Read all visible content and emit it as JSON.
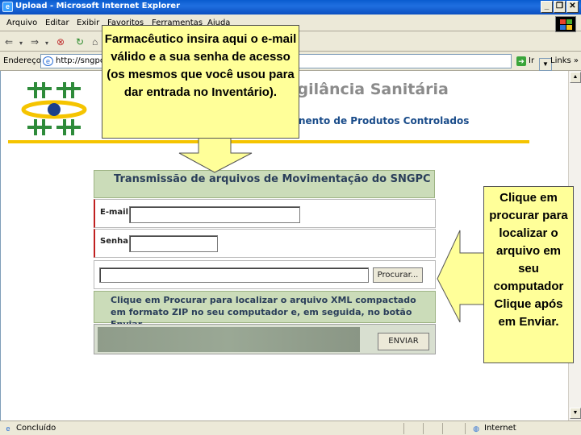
{
  "window": {
    "title": "Upload - Microsoft Internet Explorer",
    "minimize": "_",
    "restore": "❐",
    "close": "✕"
  },
  "menu": [
    "Arquivo",
    "Editar",
    "Exibir",
    "Favoritos",
    "Ferramentas",
    "Ajuda"
  ],
  "address": {
    "label": "Endereço",
    "url": "http://sngpc",
    "go_label": "Ir",
    "links_label": "Links"
  },
  "site": {
    "title": "igilância Sanitária",
    "subtitle": "nento de Produtos Controlados"
  },
  "form": {
    "header": "Transmissão de arquivos de Movimentação do SNGPC",
    "email_label": "E-mail:",
    "password_label": "Senha:",
    "browse_button": "Procurar...",
    "info": "Clique em Procurar para localizar o arquivo XML compactado em formato ZIP no seu computador e, em seguida, no botão Enviar.",
    "send_button": "ENVIAR"
  },
  "callouts": {
    "login": "Farmacêutico insira aqui o e-mail válido e a sua senha de acesso (os mesmos que você usou para dar entrada no Inventário).",
    "upload": "Clique em procurar para localizar o arquivo em seu computador Clique após em Enviar."
  },
  "status": {
    "left": "Concluído",
    "zone": "Internet"
  }
}
